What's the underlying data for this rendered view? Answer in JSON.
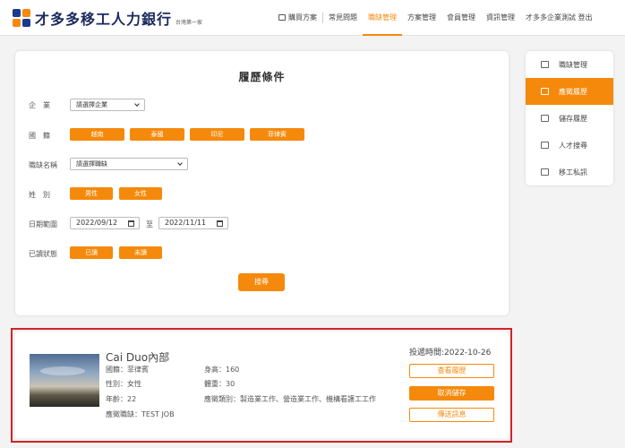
{
  "header": {
    "logo_text": "才多多移工人力銀行",
    "logo_sub": "台灣第一家",
    "nav": {
      "buy": "購買方案",
      "faq": "常見問題",
      "jobs": "職缺管理",
      "plans": "方案管理",
      "members": "會員管理",
      "info": "資訊管理",
      "account": "才多多企業測試 登出"
    }
  },
  "search": {
    "title": "履歷條件",
    "company_label": "企　業",
    "company_placeholder": "請選擇企業",
    "nationality_label": "國　籍",
    "nationalities": [
      "越南",
      "泰國",
      "印尼",
      "菲律賓"
    ],
    "job_label": "職缺名稱",
    "job_placeholder": "請選擇職缺",
    "gender_label": "姓　別",
    "genders": [
      "男性",
      "女性"
    ],
    "date_label": "日期範圍",
    "date_from": "2022/09/12",
    "date_to": "2022/11/11",
    "date_sep": "至",
    "read_label": "已讀狀態",
    "read_options": [
      "已讀",
      "未讀"
    ],
    "search_button": "搜尋"
  },
  "sidebar": {
    "items": [
      "職缺管理",
      "應徵履歷",
      "儲存履歷",
      "人才搜尋",
      "移工私訊"
    ]
  },
  "result": {
    "name": "Cai Duo內部",
    "nationality": "國籍：菲律賓",
    "gender": "性別：女性",
    "age": "年齡：22",
    "job": "應徵職缺：TEST JOB",
    "height": "身高：160",
    "weight": "體重：30",
    "category": "應徵類別：製造業工作、營造業工作、機構看護工工作",
    "time": "投遞時間:2022-10-26",
    "view_button": "查看履歷",
    "unsave_button": "取消儲存",
    "message_button": "傳送訊息"
  },
  "colors": {
    "accent": "#f5890b",
    "brand": "#1b2a5c",
    "highlight": "#d12424"
  }
}
